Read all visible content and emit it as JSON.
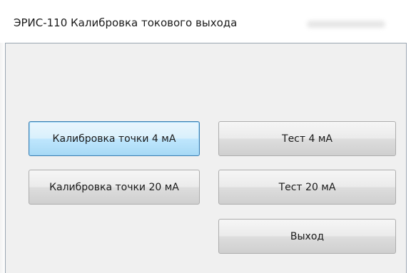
{
  "window": {
    "title": "ЭРИС-110 Калибровка токового выхода"
  },
  "buttons": {
    "calibrate_4ma": "Калибровка точки 4 мА",
    "test_4ma": "Тест 4 мА",
    "calibrate_20ma": "Калибровка точки 20 мА",
    "test_20ma": "Тест 20 мА",
    "exit": "Выход"
  },
  "colors": {
    "focused_button_border": "#3c7fb1",
    "client_background": "#f0f0f0"
  }
}
